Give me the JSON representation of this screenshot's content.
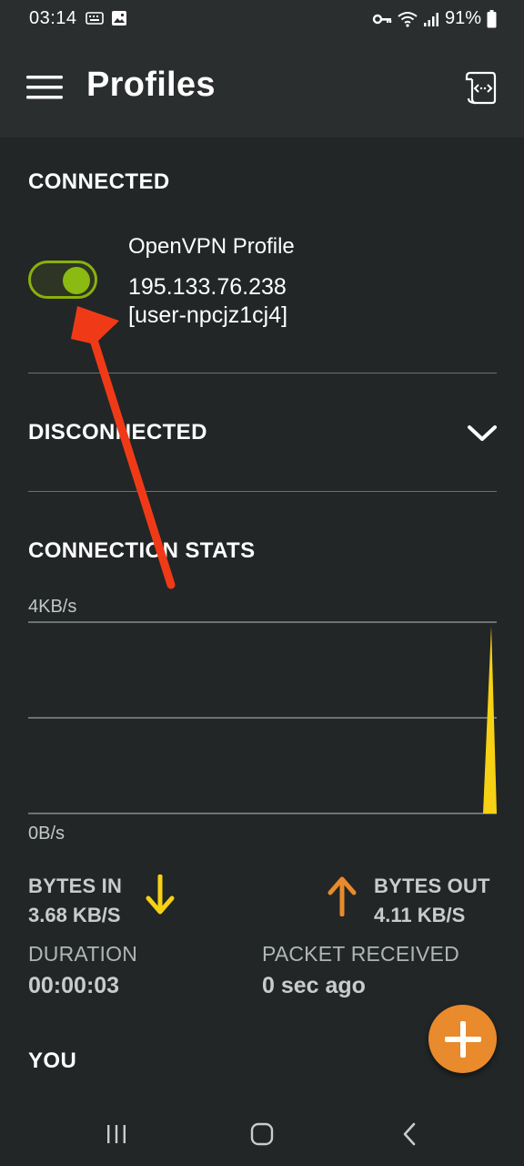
{
  "status_bar": {
    "time": "03:14",
    "battery": "91%",
    "icons": [
      "keyboard-icon",
      "image-icon",
      "key-icon",
      "wifi-icon",
      "signal-icon",
      "battery-icon"
    ]
  },
  "app_bar": {
    "title": "Profiles",
    "menu_icon": "hamburger-menu-icon",
    "action_icon": "import-profile-icon"
  },
  "connected": {
    "heading": "CONNECTED",
    "profile": {
      "name": "OpenVPN Profile",
      "server": "195.133.76.238",
      "user": "[user-npcjz1cj4]",
      "toggle_on": true
    }
  },
  "disconnected": {
    "heading": "DISCONNECTED",
    "expand_icon": "chevron-down-icon"
  },
  "stats": {
    "heading": "CONNECTION STATS",
    "chart_max_label": "4KB/s",
    "chart_min_label": "0B/s",
    "bytes_in_label": "BYTES IN",
    "bytes_in_value": "3.68 KB/S",
    "bytes_out_label": "BYTES OUT",
    "bytes_out_value": "4.11 KB/S",
    "duration_label": "DURATION",
    "duration_value": "00:00:03",
    "packet_label": "PACKET RECEIVED",
    "packet_value": "0 sec ago"
  },
  "you": {
    "heading": "YOU"
  },
  "colors": {
    "background": "#222626",
    "app_bar": "#2a2e2e",
    "toggle_green": "#8bba12",
    "fab_orange": "#e98a2c",
    "bytes_in_yellow": "#f7d114",
    "bytes_out_orange": "#e98a2c",
    "annotation_red": "#f03a17"
  }
}
